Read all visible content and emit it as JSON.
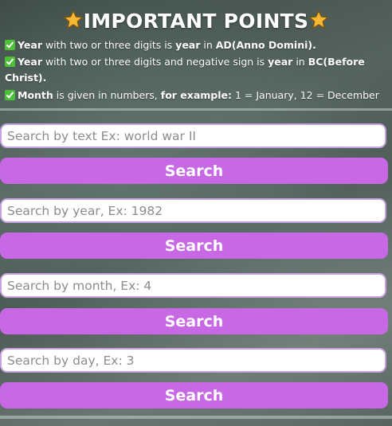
{
  "header": {
    "title": "IMPORTANT POINTS",
    "points": [
      {
        "term": "Year",
        "mid": " with two or three digits is ",
        "term2": "year",
        "in": " in ",
        "era": "AD(Anno Domini)",
        "end": "."
      },
      {
        "term": "Year",
        "mid": " with two or three digits and negative sign is ",
        "term2": "year",
        "in": " in ",
        "era_line1": "BC(Before",
        "era_line2": "Christ)",
        "end": "."
      },
      {
        "term": "Month",
        "mid": " is given in numbers, ",
        "example_label": "for example:",
        "example_text": " 1 = January, 12 = December"
      }
    ]
  },
  "search_text": {
    "placeholder": "Search by text Ex: world war II",
    "value": "",
    "button": "Search"
  },
  "search_year": {
    "placeholder": "Search by year, Ex: 1982",
    "value": "",
    "button": "Search"
  },
  "search_month": {
    "placeholder": "Search by month, Ex: 4",
    "value": "",
    "button": "Search"
  },
  "search_day": {
    "placeholder": "Search by day, Ex: 3",
    "value": "",
    "button": "Search"
  },
  "colors": {
    "button": "#c768e4",
    "input_border": "#c8a2e0",
    "check": "#4fbf3a",
    "star": "#f5b731"
  },
  "icons": {
    "title_star": "star-icon",
    "point_check": "check-mark-icon"
  }
}
